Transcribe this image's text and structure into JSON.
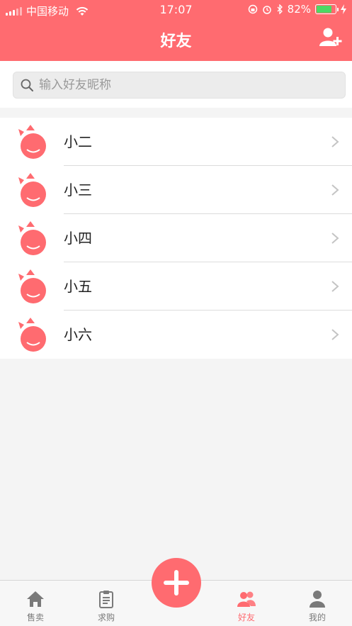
{
  "status_bar": {
    "carrier": "中国移动",
    "time": "17:07",
    "battery": "82%",
    "battery_level": 0.82
  },
  "nav": {
    "title": "好友",
    "add_friend_icon": "add-user-icon"
  },
  "search": {
    "placeholder": "输入好友昵称",
    "value": ""
  },
  "friends": [
    {
      "name": "小二"
    },
    {
      "name": "小三"
    },
    {
      "name": "小四"
    },
    {
      "name": "小五"
    },
    {
      "name": "小六"
    }
  ],
  "tabbar": {
    "tabs": [
      {
        "label": "售卖",
        "icon": "home-icon"
      },
      {
        "label": "求购",
        "icon": "clipboard-icon"
      },
      {
        "label": "好友",
        "icon": "friends-icon",
        "active": true
      },
      {
        "label": "我的",
        "icon": "person-icon"
      }
    ],
    "fab_icon": "plus-icon"
  },
  "colors": {
    "accent": "#ff6b70",
    "battery_green": "#4cd964"
  }
}
